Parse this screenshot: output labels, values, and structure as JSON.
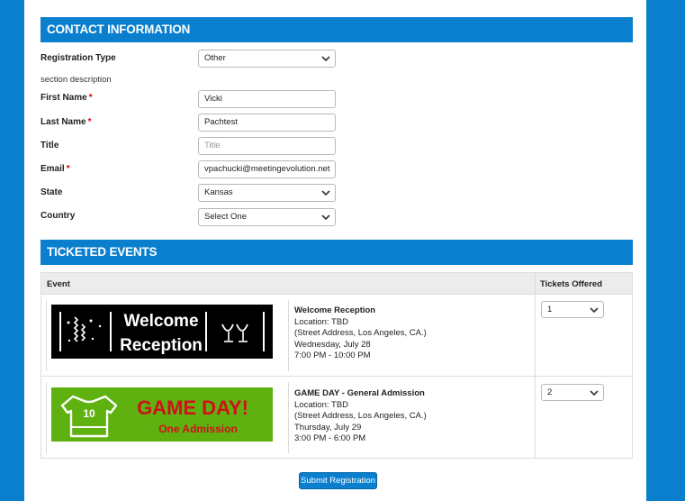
{
  "contact": {
    "header": "CONTACT INFORMATION",
    "registration_type": {
      "label": "Registration Type",
      "value": "Other"
    },
    "section_description": "section description",
    "first_name": {
      "label": "First Name",
      "value": "Vicki",
      "required_mark": "*"
    },
    "last_name": {
      "label": "Last Name",
      "value": "Pachtest",
      "required_mark": "*"
    },
    "title": {
      "label": "Title",
      "placeholder": "Title"
    },
    "email": {
      "label": "Email",
      "value": "vpachucki@meetingevolution.net",
      "required_mark": "*"
    },
    "state": {
      "label": "State",
      "value": "Kansas"
    },
    "country": {
      "label": "Country",
      "value": "Select One"
    }
  },
  "ticketed_events": {
    "header": "TICKETED EVENTS",
    "col_event": "Event",
    "col_tickets": "Tickets Offered",
    "events": [
      {
        "banner_line1": "Welcome",
        "banner_line2": "Reception",
        "title": "Welcome Reception",
        "location": "Location: TBD",
        "address": "(Street Address, Los Angeles, CA.)",
        "date": "Wednesday, July 28",
        "time": "7:00 PM - 10:00 PM",
        "tickets": "1",
        "banner_bg": "#000000"
      },
      {
        "banner_line1": "GAME DAY!",
        "banner_line2": "One Admission",
        "jersey_number": "10",
        "title": "GAME DAY - General Admission",
        "location": "Location: TBD",
        "address": "(Street Address, Los Angeles, CA.)",
        "date": "Thursday, July 29",
        "time": "3:00 PM - 6:00 PM",
        "tickets": "2",
        "banner_bg": "#5fb10f",
        "banner_text_color": "#d0101a"
      }
    ]
  },
  "submit_label": "Submit Registration",
  "colors": {
    "accent": "#0a7fce",
    "required": "#dd0000"
  }
}
